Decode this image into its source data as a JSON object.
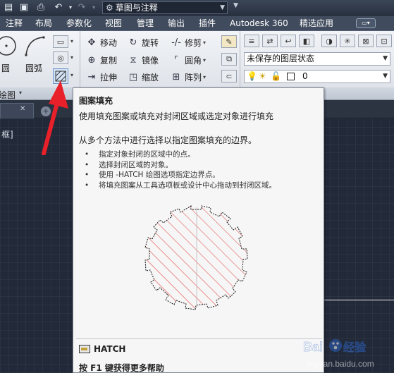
{
  "titlebar": {
    "workspace": "草图与注释"
  },
  "ribbon_tabs": [
    "注释",
    "布局",
    "参数化",
    "视图",
    "管理",
    "输出",
    "插件",
    "Autodesk 360",
    "精选应用"
  ],
  "draw_panel": {
    "circle_label": "圆",
    "arc_label": "圆弧",
    "title": "绘图"
  },
  "modify_panel": {
    "move": "移动",
    "rotate": "旋转",
    "trim": "修剪",
    "copy": "复制",
    "mirror": "镜像",
    "fillet": "圆角",
    "stretch": "拉伸",
    "scale": "缩放",
    "array": "阵列"
  },
  "layers_panel": {
    "layer_state": "未保存的图层状态",
    "current_layer": "0"
  },
  "viewport_label": "框]",
  "tooltip": {
    "title": "图案填充",
    "description": "使用填充图案或填充对封闭区域或选定对象进行填充",
    "subtitle": "从多个方法中进行选择以指定图案填充的边界。",
    "bullets": [
      "指定对象封闭的区域中的点。",
      "选择封闭区域的对象。",
      "使用 -HATCH 绘图选项指定边界点。",
      "将填充图案从工具选项板或设计中心拖动到封闭区域。"
    ],
    "command": "HATCH",
    "help": "按 F1 键获得更多帮助"
  },
  "colors": {
    "hatch_red": "#e03030",
    "arrow_red": "#e8202a",
    "drawing_bg": "#222938"
  }
}
